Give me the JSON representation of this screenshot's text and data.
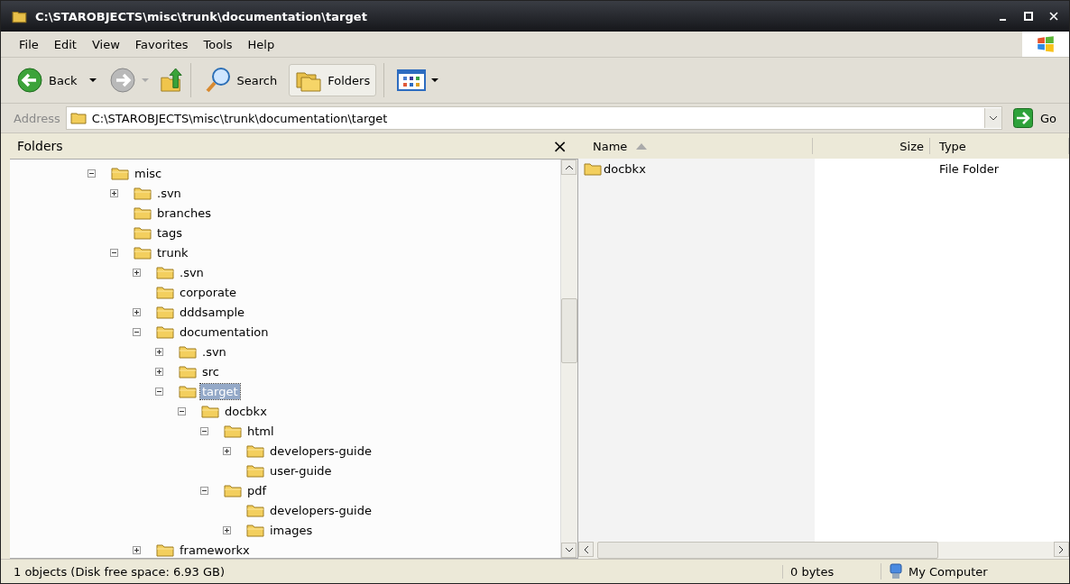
{
  "window": {
    "title": "C:\\STAROBJECTS\\misc\\trunk\\documentation\\target"
  },
  "menu": [
    "File",
    "Edit",
    "View",
    "Favorites",
    "Tools",
    "Help"
  ],
  "toolbar": {
    "back": "Back",
    "search": "Search",
    "folders": {
      "label": "Folders",
      "selected": true
    }
  },
  "address": {
    "label": "Address",
    "value": "C:\\STAROBJECTS\\misc\\trunk\\documentation\\target",
    "go": "Go"
  },
  "folders_pane": {
    "title": "Folders",
    "close": "×",
    "tree": [
      {
        "name": "misc",
        "expanded": true,
        "selected": false,
        "children": [
          {
            "name": ".svn",
            "expanded": false,
            "selected": false
          },
          {
            "name": "branches",
            "selected": false
          },
          {
            "name": "tags",
            "selected": false
          },
          {
            "name": "trunk",
            "expanded": true,
            "selected": false,
            "children": [
              {
                "name": ".svn",
                "expanded": false,
                "selected": false
              },
              {
                "name": "corporate",
                "selected": false
              },
              {
                "name": "dddsample",
                "expanded": false,
                "selected": false
              },
              {
                "name": "documentation",
                "expanded": true,
                "selected": false,
                "children": [
                  {
                    "name": ".svn",
                    "expanded": false,
                    "selected": false
                  },
                  {
                    "name": "src",
                    "expanded": false,
                    "selected": false
                  },
                  {
                    "name": "target",
                    "expanded": true,
                    "selected": true,
                    "children": [
                      {
                        "name": "docbkx",
                        "expanded": true,
                        "selected": false,
                        "children": [
                          {
                            "name": "html",
                            "expanded": true,
                            "selected": false,
                            "children": [
                              {
                                "name": "developers-guide",
                                "expanded": false,
                                "selected": false
                              },
                              {
                                "name": "user-guide",
                                "selected": false
                              }
                            ]
                          },
                          {
                            "name": "pdf",
                            "expanded": true,
                            "selected": false,
                            "children": [
                              {
                                "name": "developers-guide",
                                "selected": false
                              },
                              {
                                "name": "images",
                                "expanded": false,
                                "selected": false
                              }
                            ]
                          }
                        ]
                      }
                    ]
                  }
                ]
              },
              {
                "name": "frameworkx",
                "expanded": false,
                "selected": false
              }
            ]
          }
        ]
      }
    ]
  },
  "file_list": {
    "columns": [
      "Name",
      "Size",
      "Type"
    ],
    "rows": [
      {
        "name": "docbkx",
        "size": "",
        "type": "File Folder"
      }
    ]
  },
  "status_bar": {
    "objects": "1 objects (Disk free space: 6.93 GB)",
    "size": "0 bytes",
    "zone": "My Computer"
  }
}
